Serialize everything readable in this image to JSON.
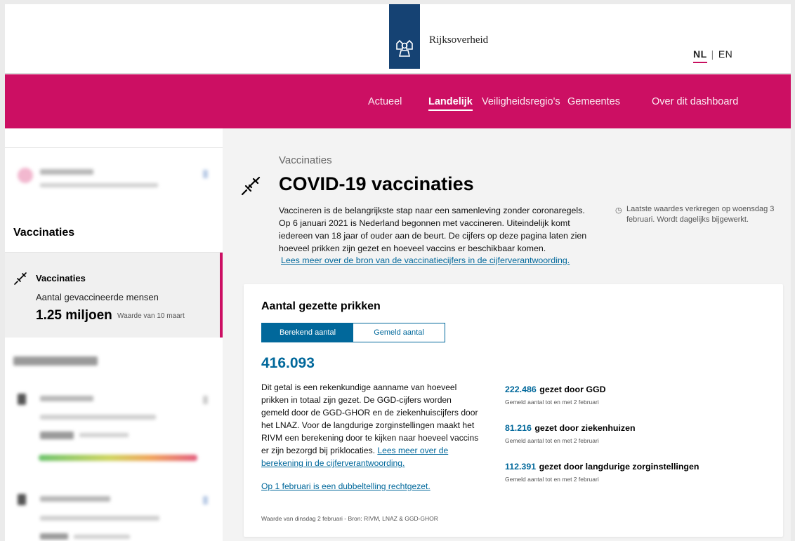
{
  "header": {
    "logo_text": "Rijksoverheid",
    "lang_nl": "NL",
    "lang_sep": "|",
    "lang_en": "EN"
  },
  "nav": {
    "items": [
      "Actueel",
      "Landelijk",
      "Veiligheidsregio's",
      "Gemeentes",
      "Over dit dashboard"
    ],
    "active": "Landelijk"
  },
  "sidebar": {
    "section_title": "Vaccinaties",
    "active_item": {
      "title": "Vaccinaties",
      "subtitle": "Aantal gevaccineerde mensen",
      "value": "1.25 miljoen",
      "value_note": "Waarde van 10 maart"
    }
  },
  "main": {
    "breadcrumb": "Vaccinaties",
    "title": "COVID-19 vaccinaties",
    "intro": "Vaccineren is de belangrijkste stap naar een samenleving zonder coronaregels. Op 6 januari 2021 is Nederland begonnen met vaccineren. Uiteindelijk komt iedereen van 18 jaar of ouder aan de beurt. De cijfers op deze pagina laten zien hoeveel prikken zijn gezet en hoeveel vaccins er beschikbaar komen.",
    "intro_link": "Lees meer over de bron van de vaccinatiecijfers in de cijferverantwoording.",
    "updated": "Laatste waardes verkregen op woensdag 3 februari. Wordt dagelijks bijgewerkt."
  },
  "card": {
    "title": "Aantal gezette prikken",
    "tab_calculated": "Berekend aantal",
    "tab_reported": "Gemeld aantal",
    "big_number": "416.093",
    "description": "Dit getal is een rekenkundige aanname van hoeveel prikken in totaal zijn gezet. De GGD-cijfers worden gemeld door de GGD-GHOR en de ziekenhuiscijfers door het LNAZ. Voor de langdurige zorginstellingen maakt het RIVM een berekening door te kijken naar hoeveel vaccins er zijn bezorgd bij priklocaties.",
    "description_link": "Lees meer over de berekening in de cijferverantwoording.",
    "double_count_link": "Op 1 februari is een dubbeltelling rechtgezet.",
    "source": "Waarde van dinsdag 2 februari - Bron: RIVM, LNAZ & GGD-GHOR",
    "stats": [
      {
        "value": "222.486",
        "label": "gezet door GGD",
        "sub": "Gemeld aantal tot en met 2 februari"
      },
      {
        "value": "81.216",
        "label": "gezet door ziekenhuizen",
        "sub": "Gemeld aantal tot en met 2 februari"
      },
      {
        "value": "112.391",
        "label": "gezet door langdurige zorginstellingen",
        "sub": "Gemeld aantal tot en met 2 februari"
      }
    ]
  },
  "colors": {
    "brand_pink": "#cc0f63",
    "link_blue": "#01689b",
    "logo_blue": "#154273"
  },
  "icons": [
    "rijksoverheid-logo-icon",
    "syringe-icon",
    "clock-icon",
    "chevron-right-icon"
  ]
}
